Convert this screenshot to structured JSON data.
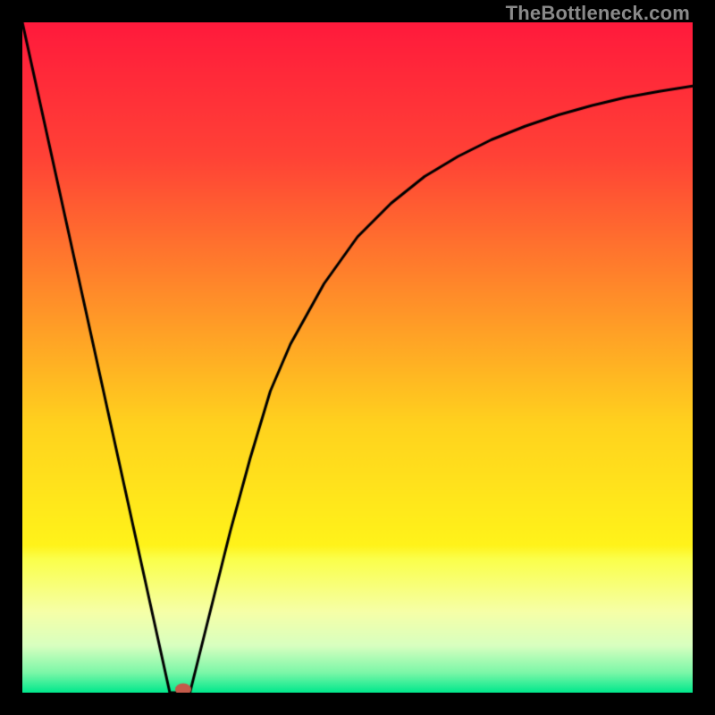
{
  "watermark": "TheBottleneck.com",
  "chart_data": {
    "type": "line",
    "title": "",
    "xlabel": "",
    "ylabel": "",
    "xlim": [
      0,
      100
    ],
    "ylim": [
      0,
      100
    ],
    "grid": false,
    "legend": false,
    "gradient_stops": [
      {
        "pos": 0.0,
        "color": "#ff1a3c"
      },
      {
        "pos": 0.2,
        "color": "#ff4236"
      },
      {
        "pos": 0.4,
        "color": "#ff8a2a"
      },
      {
        "pos": 0.6,
        "color": "#ffd21e"
      },
      {
        "pos": 0.78,
        "color": "#fff31a"
      },
      {
        "pos": 0.8,
        "color": "#fbff4a"
      },
      {
        "pos": 0.88,
        "color": "#f6ffa8"
      },
      {
        "pos": 0.93,
        "color": "#d8ffc0"
      },
      {
        "pos": 0.97,
        "color": "#7cf7a8"
      },
      {
        "pos": 1.0,
        "color": "#00e88c"
      }
    ],
    "series": [
      {
        "name": "left-branch",
        "x": [
          0,
          22
        ],
        "y": [
          100,
          0
        ],
        "color": "#000000"
      },
      {
        "name": "valley-floor",
        "x": [
          22,
          25
        ],
        "y": [
          0,
          0
        ],
        "color": "#000000"
      },
      {
        "name": "right-branch",
        "x": [
          25,
          28,
          31,
          34,
          37,
          40,
          45,
          50,
          55,
          60,
          65,
          70,
          75,
          80,
          85,
          90,
          95,
          100
        ],
        "y": [
          0,
          12,
          24,
          35,
          45,
          52,
          61,
          68,
          73,
          77,
          80,
          82.5,
          84.5,
          86.2,
          87.6,
          88.8,
          89.7,
          90.5
        ],
        "color": "#000000"
      }
    ],
    "marker": {
      "x": 24,
      "y": 0.5,
      "rx": 1.2,
      "ry": 0.9,
      "color": "#c45a4a"
    }
  }
}
